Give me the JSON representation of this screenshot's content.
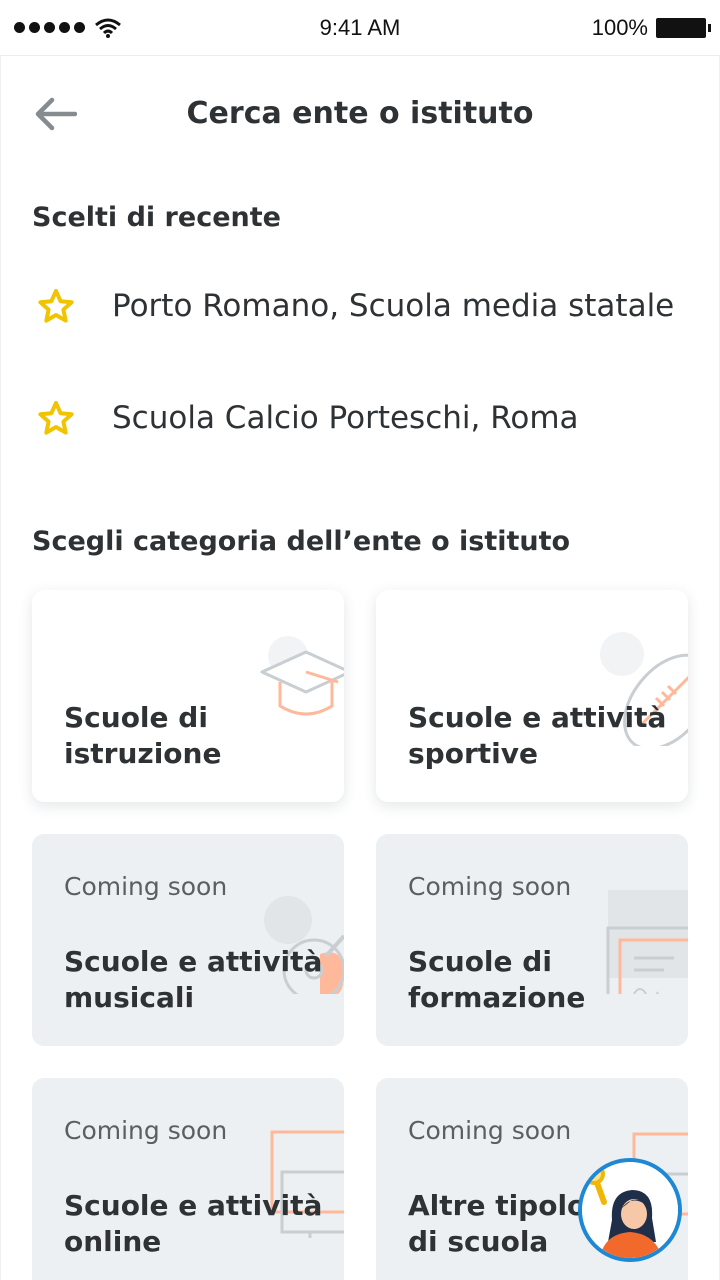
{
  "status_bar": {
    "time": "9:41 AM",
    "battery": "100%"
  },
  "header": {
    "title": "Cerca ente o istituto"
  },
  "recent": {
    "title": "Scelti di recente",
    "items": [
      {
        "label": "Porto Romano, Scuola media statale"
      },
      {
        "label": "Scuola Calcio Porteschi, Roma"
      }
    ]
  },
  "categories": {
    "title": "Scegli categoria dell’ente o istituto",
    "items": [
      {
        "title": "Scuole di\nistruzione"
      },
      {
        "title": "Scuole e attività\nsportive"
      },
      {
        "badge": "Coming soon",
        "title": "Scuole e attività\nmusicali"
      },
      {
        "badge": "Coming soon",
        "title": "Scuole di\nformazione"
      },
      {
        "badge": "Coming soon",
        "title": "Scuole e attività\nonline"
      },
      {
        "badge": "Coming soon",
        "title": "Altre tipologie\ndi scuola"
      }
    ]
  },
  "colors": {
    "star": "#f2c300",
    "accent": "#ff8a50",
    "avatar_ring": "#1e88d4"
  }
}
